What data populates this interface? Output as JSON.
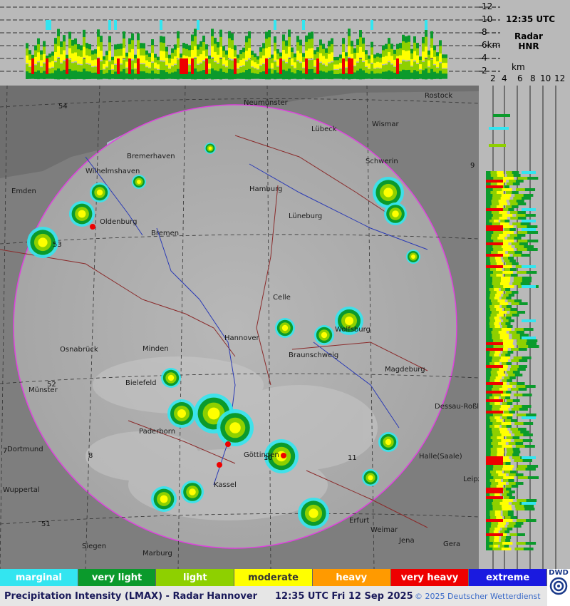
{
  "header": {
    "time": "12:35 UTC",
    "radar_label": "Radar",
    "radar_code": "HNR"
  },
  "top_profile": {
    "height_ticks": [
      "12",
      "10",
      "8",
      "6km",
      "4",
      "2"
    ]
  },
  "side_profile": {
    "unit": "km",
    "distance_ticks": [
      "2",
      "4",
      "6",
      "8",
      "10",
      "12"
    ]
  },
  "legend": [
    {
      "label": "marginal",
      "color": "#33e5f0"
    },
    {
      "label": "very light",
      "color": "#0b9a2c"
    },
    {
      "label": "light",
      "color": "#8ed000"
    },
    {
      "label": "moderate",
      "color": "#ffff00"
    },
    {
      "label": "heavy",
      "color": "#ff9a00"
    },
    {
      "label": "very heavy",
      "color": "#ee0000"
    },
    {
      "label": "extreme",
      "color": "#1a1ae0"
    }
  ],
  "footer": {
    "title": "Precipitation Intensity (LMAX) - Radar Hannover",
    "time": "12:35 UTC Fri 12 Sep 2025",
    "copyright": "© 2025 Deutscher Wetterdienst"
  },
  "logo": {
    "text": "DWD"
  },
  "map": {
    "cities": [
      {
        "name": "Neumünster"
      },
      {
        "name": "Rostock"
      },
      {
        "name": "Lübeck"
      },
      {
        "name": "Wismar"
      },
      {
        "name": "Bremerhaven"
      },
      {
        "name": "Wilhelmshaven"
      },
      {
        "name": "Schwerin"
      },
      {
        "name": "Hamburg"
      },
      {
        "name": "Emden"
      },
      {
        "name": "Oldenburg"
      },
      {
        "name": "Bremen"
      },
      {
        "name": "Lüneburg"
      },
      {
        "name": "Celle"
      },
      {
        "name": "Wolfsburg"
      },
      {
        "name": "Hannover"
      },
      {
        "name": "Braunschweig"
      },
      {
        "name": "Osnabrück"
      },
      {
        "name": "Minden"
      },
      {
        "name": "Magdeburg"
      },
      {
        "name": "Bielefeld"
      },
      {
        "name": "Münster"
      },
      {
        "name": "Dessau-Roßl"
      },
      {
        "name": "Paderborn"
      },
      {
        "name": "Dortmund"
      },
      {
        "name": "Göttingen"
      },
      {
        "name": "Halle(Saale)"
      },
      {
        "name": "Leipz"
      },
      {
        "name": "Wuppertal"
      },
      {
        "name": "Kassel"
      },
      {
        "name": "Erfurt"
      },
      {
        "name": "Weimar"
      },
      {
        "name": "Jena"
      },
      {
        "name": "Siegen"
      },
      {
        "name": "Marburg"
      },
      {
        "name": "Gera"
      }
    ],
    "grid_labels": [
      {
        "text": "54"
      },
      {
        "text": "53"
      },
      {
        "text": "52"
      },
      {
        "text": "51"
      },
      {
        "text": "7"
      },
      {
        "text": "8"
      },
      {
        "text": "10"
      },
      {
        "text": "11"
      },
      {
        "text": "9"
      }
    ]
  }
}
